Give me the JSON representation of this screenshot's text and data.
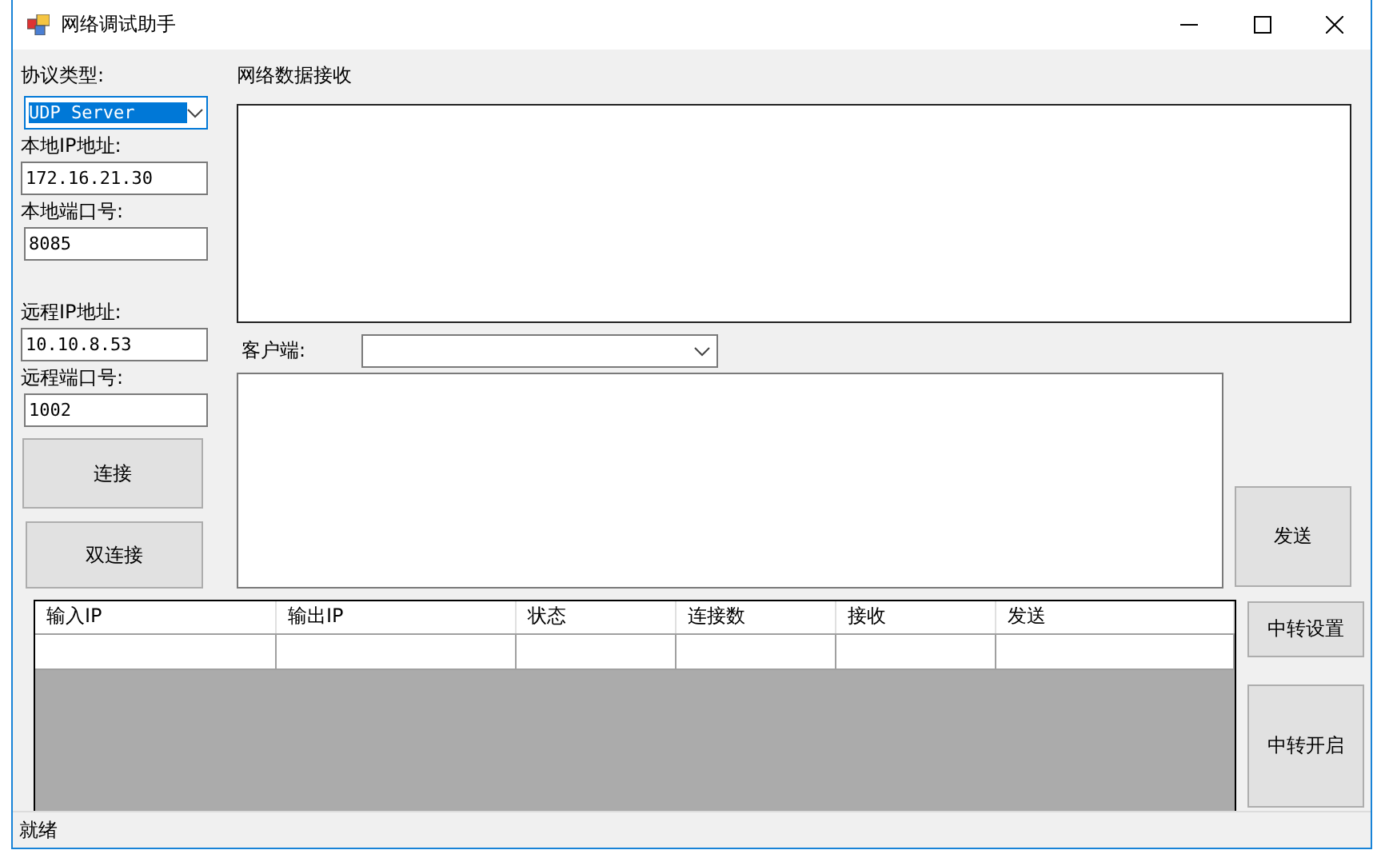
{
  "window": {
    "title": "网络调试助手"
  },
  "settings": {
    "protocol_label": "协议类型:",
    "protocol_value": "UDP Server",
    "local_ip_label": "本地IP地址:",
    "local_ip": "172.16.21.30",
    "local_port_label": "本地端口号:",
    "local_port": "8085",
    "remote_ip_label": "远程IP地址:",
    "remote_ip": "10.10.8.53",
    "remote_port_label": "远程端口号:",
    "remote_port": "1002"
  },
  "buttons": {
    "connect": "连接",
    "dual_connect": "双连接",
    "send": "发送",
    "relay_settings": "中转设置",
    "relay_start": "中转开启"
  },
  "receive": {
    "label": "网络数据接收"
  },
  "client": {
    "label": "客户端:"
  },
  "table": {
    "columns": [
      "输入IP",
      "输出IP",
      "状态",
      "连接数",
      "接收",
      "发送"
    ]
  },
  "status_bar": {
    "text": "就绪"
  }
}
